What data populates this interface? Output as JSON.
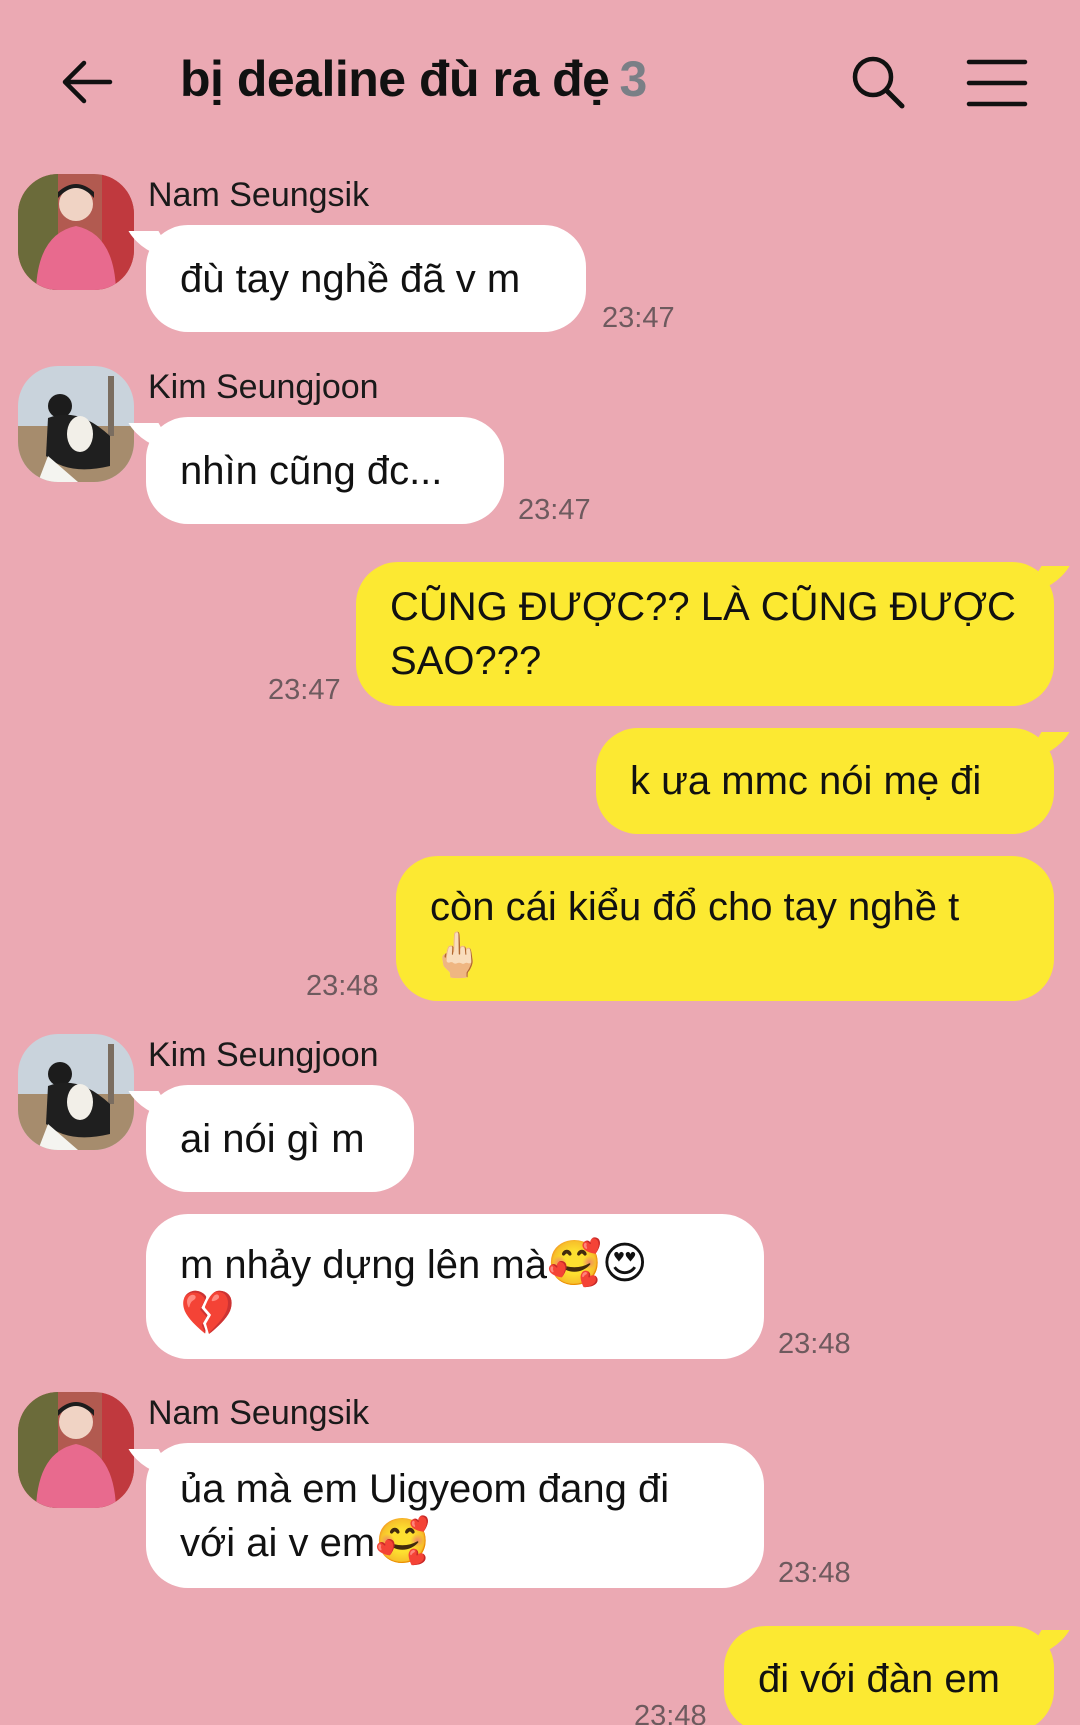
{
  "header": {
    "title": "bị dealine đù ra đẹ",
    "member_count": "3"
  },
  "messages": [
    {
      "sender": "Nam Seungsik",
      "text": "đù tay nghề đã v m",
      "time": "23:47",
      "direction": "incoming"
    },
    {
      "sender": "Kim Seungjoon",
      "text": "nhìn cũng đc...",
      "time": "23:47",
      "direction": "incoming"
    },
    {
      "text": "CŨNG ĐƯỢC?? LÀ CŨNG ĐƯỢC SAO???",
      "time": "23:47",
      "direction": "outgoing"
    },
    {
      "text": "k ưa mmc nói mẹ đi",
      "direction": "outgoing"
    },
    {
      "text": "còn cái kiểu đổ cho tay nghề t",
      "emoji": "🖕🏻",
      "time": "23:48",
      "direction": "outgoing"
    },
    {
      "sender": "Kim Seungjoon",
      "text": "ai nói gì m",
      "direction": "incoming"
    },
    {
      "text": "m nhảy dựng lên mà",
      "emoji": "🥰😍",
      "emoji2": "💔",
      "time": "23:48",
      "direction": "incoming"
    },
    {
      "sender": "Nam Seungsik",
      "text": "ủa mà em Uigyeom đang đi",
      "text2": "với ai v em",
      "emoji": "🥰",
      "time": "23:48",
      "direction": "incoming"
    },
    {
      "text": "đi với đàn em",
      "time": "23:48",
      "direction": "outgoing"
    }
  ],
  "colors": {
    "background": "#EBA9B3",
    "incoming_bubble": "#FFFFFF",
    "outgoing_bubble": "#FCE932"
  },
  "icons": [
    "arrow-left-icon",
    "search-icon",
    "menu-icon"
  ]
}
